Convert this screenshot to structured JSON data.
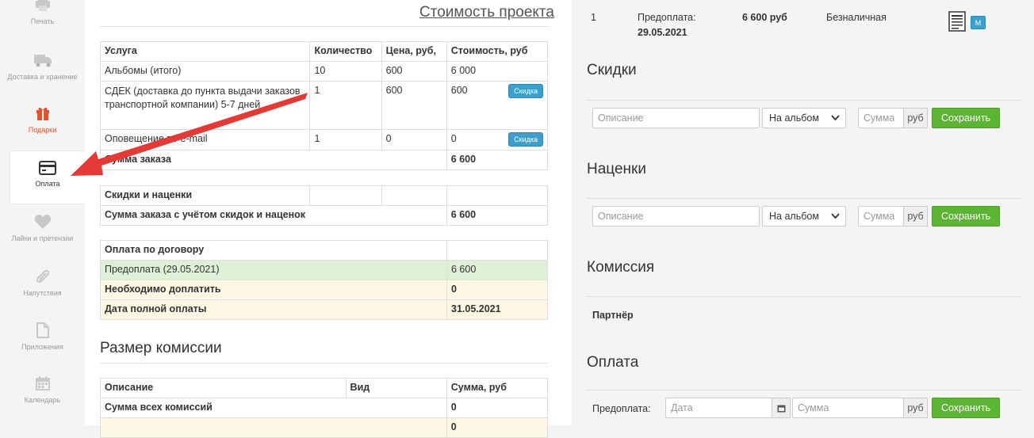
{
  "sidebar": {
    "items": [
      {
        "label": "Печать",
        "icon": "printer-icon"
      },
      {
        "label": "Доставка и хранение",
        "icon": "truck-icon"
      },
      {
        "label": "Подарки",
        "icon": "gift-icon"
      },
      {
        "label": "Оплата",
        "icon": "credit-card-icon"
      },
      {
        "label": "Лайки и претензии",
        "icon": "heart-icon"
      },
      {
        "label": "Напутствия",
        "icon": "paperclip-icon"
      },
      {
        "label": "Приложения",
        "icon": "file-icon"
      },
      {
        "label": "Календарь",
        "icon": "calendar-icon"
      }
    ],
    "active": "Оплата"
  },
  "middle": {
    "project_cost_title": "Стоимость проекта",
    "services": {
      "headers": [
        "Услуга",
        "Количество",
        "Цена, руб,",
        "Стоимость, руб"
      ],
      "rows": [
        {
          "service": "Альбомы (итого)",
          "qty": "10",
          "price": "600",
          "cost": "6 000"
        },
        {
          "service": "СДЕК (доставка до пункта выдачи заказов транспортной компании) 5-7 дней",
          "qty": "1",
          "price": "600",
          "cost": "600",
          "button": "Скидка"
        },
        {
          "service": "Оповещение по e-mail",
          "qty": "1",
          "price": "0",
          "cost": "0",
          "button": "Скидка"
        }
      ],
      "total_label": "Сумма заказа",
      "total_value": "6 600"
    },
    "discounts": {
      "header": "Скидки и наценки",
      "total_label": "Сумма заказа с учётом скидок и наценок",
      "total_value": "6 600"
    },
    "contract_payment": {
      "header": "Оплата по договору",
      "rows": [
        {
          "label": "Предоплата (29.05.2021)",
          "value": "6 600"
        },
        {
          "label": "Необходимо доплатить",
          "value": "0"
        },
        {
          "label": "Дата полной оплаты",
          "value": "31.05.2021"
        }
      ]
    },
    "commission_title": "Размер комиссии",
    "commission": {
      "headers": [
        "Описание",
        "Вид",
        "Сумма, руб"
      ],
      "total_label": "Сумма всех комиссий",
      "total_value": "0",
      "last_value": "0"
    }
  },
  "right": {
    "payment_row": {
      "num": "1",
      "label": "Предоплата:",
      "date": "29.05.2021",
      "amount": "6 600 руб",
      "method": "Безналичная",
      "badge": "М"
    },
    "discounts_title": "Скидки",
    "markups_title": "Наценки",
    "commission_title": "Комиссия",
    "partner_label": "Партнёр",
    "payment_title": "Оплата",
    "form": {
      "description_placeholder": "Описание",
      "scope_value": "На альбом",
      "sum_placeholder": "Сумма",
      "currency": "руб",
      "save_label": "Сохранить",
      "prepay_label": "Предоплата:",
      "date_placeholder": "Дата"
    }
  },
  "colors": {
    "accent_green": "#5cb532",
    "accent_blue": "#3ba0cc",
    "arrow_red": "#e53935",
    "row_green": "#dff0d8",
    "row_yellow": "#fcf8e3"
  }
}
